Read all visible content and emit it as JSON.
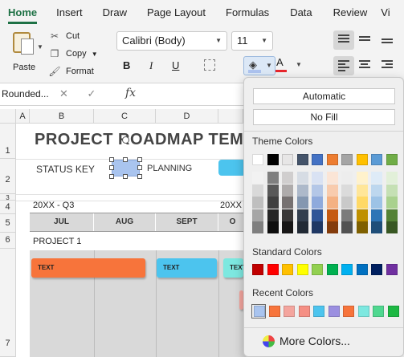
{
  "ribbon_tabs": [
    {
      "label": "Home",
      "active": true
    },
    {
      "label": "Insert"
    },
    {
      "label": "Draw"
    },
    {
      "label": "Page Layout"
    },
    {
      "label": "Formulas"
    },
    {
      "label": "Data"
    },
    {
      "label": "Review"
    },
    {
      "label": "Vi"
    }
  ],
  "clipboard": {
    "paste": "Paste",
    "cut": "Cut",
    "copy": "Copy",
    "format": "Format"
  },
  "font": {
    "name": "Calibri (Body)",
    "size": "11",
    "bold": "B",
    "italic": "I",
    "underline": "U",
    "font_color_glyph": "A"
  },
  "formula_bar": {
    "name_box": "Rounded...",
    "fx": "fx"
  },
  "columns": [
    "A",
    "B",
    "C",
    "D"
  ],
  "rows": [
    "1",
    "2",
    "3",
    "4",
    "5",
    "6",
    "7"
  ],
  "sheet": {
    "title": "PROJECT ROADMAP TEMP",
    "status_key": "STATUS KEY",
    "planning": "PLANNING",
    "q3_label": "20XX - Q3",
    "q4_label": "20XX",
    "months": [
      "JUL",
      "AUG",
      "SEPT",
      "O"
    ],
    "project": "PROJECT 1",
    "bars": [
      {
        "label": "TEXT",
        "color": "#f7743b"
      },
      {
        "label": "TEXT",
        "color": "#4cc4ee"
      },
      {
        "label": "TEXT",
        "color": "#7de8e0"
      }
    ]
  },
  "fill_popup": {
    "automatic": "Automatic",
    "no_fill": "No Fill",
    "theme_title": "Theme Colors",
    "theme_colors": [
      "#ffffff",
      "#000000",
      "#e7e6e6",
      "#44546a",
      "#4472c4",
      "#ed7d31",
      "#a5a5a5",
      "#ffc000",
      "#5b9bd5",
      "#70ad47"
    ],
    "theme_shades": [
      [
        "#f2f2f2",
        "#d9d9d9",
        "#bfbfbf",
        "#a6a6a6",
        "#7f7f7f"
      ],
      [
        "#7f7f7f",
        "#595959",
        "#404040",
        "#262626",
        "#0d0d0d"
      ],
      [
        "#d0cece",
        "#aeabab",
        "#767171",
        "#3a3838",
        "#171616"
      ],
      [
        "#d6dce4",
        "#adb9ca",
        "#8497b0",
        "#333f4f",
        "#222a35"
      ],
      [
        "#d9e2f3",
        "#b4c7e7",
        "#8faadc",
        "#2f5597",
        "#1f3864"
      ],
      [
        "#fbe5d6",
        "#f8cbad",
        "#f4b183",
        "#c55a11",
        "#843c0c"
      ],
      [
        "#ededed",
        "#dbdbdb",
        "#c9c9c9",
        "#7b7b7b",
        "#525252"
      ],
      [
        "#fff2cc",
        "#ffe699",
        "#ffd966",
        "#bf9000",
        "#7f6000"
      ],
      [
        "#deebf7",
        "#bdd7ee",
        "#9dc3e6",
        "#2e75b6",
        "#1f4e79"
      ],
      [
        "#e2f0d9",
        "#c5e0b4",
        "#a9d18e",
        "#548235",
        "#385723"
      ]
    ],
    "standard_title": "Standard Colors",
    "standard_colors": [
      "#c00000",
      "#ff0000",
      "#ffc000",
      "#ffff00",
      "#92d050",
      "#00b050",
      "#00b0f0",
      "#0070c0",
      "#002060",
      "#7030a0"
    ],
    "recent_title": "Recent Colors",
    "recent_colors": [
      "#a9c4ef",
      "#f7743b",
      "#f4a59e",
      "#f58f84",
      "#4cc4ee",
      "#9b8fe0",
      "#f7743b",
      "#7de8e0",
      "#50d890",
      "#1db843"
    ],
    "more_colors": "More Colors..."
  }
}
